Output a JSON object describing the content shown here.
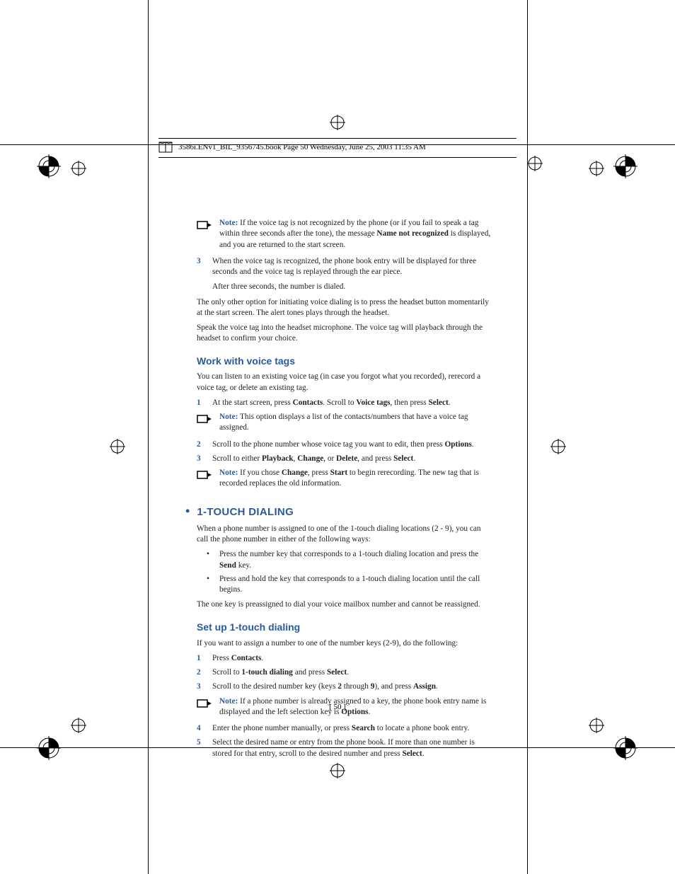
{
  "header": {
    "filename_line": "3586i.ENv1_BIL_9356745.book  Page 50  Wednesday, June 25, 2003  11:35 AM"
  },
  "page_number_display": "[ 50 ]",
  "notes": {
    "label": "Note:",
    "n1_a": " If the voice tag is not recognized by the phone (or if you fail to speak a tag within three seconds after the tone), the message ",
    "n1_bold": "Name not recognized",
    "n1_b": " is displayed, and you are returned to the start screen.",
    "n2": " This option displays a list of the contacts/numbers that have a voice tag assigned.",
    "n3_a": " If you chose ",
    "n3_b1": "Change",
    "n3_c": ", press ",
    "n3_b2": "Start",
    "n3_d": " to begin rerecording. The new tag that is recorded replaces the old information.",
    "n4_a": " If a phone number is already assigned to a key, the phone book entry name is displayed and the left selection key is ",
    "n4_b": "Options",
    "n4_c": "."
  },
  "steps_a": {
    "s3_a": "When the voice tag is recognized, the phone book entry will be displayed for three seconds and the voice tag is replayed through the ear piece.",
    "s3_b": "After three seconds, the number is dialed."
  },
  "paras": {
    "p1": "The only other option for initiating voice dialing is to press the headset button momentarily at the start screen. The alert tones plays through the headset.",
    "p2": "Speak the voice tag into the headset microphone. The voice tag will playback through the headset to confirm your choice.",
    "p3": "You can listen to an existing voice tag (in case you forgot what you recorded), rerecord a voice tag, or delete an existing tag.",
    "p4": "When a phone number is assigned to one of the 1-touch dialing locations (2 - 9), you can call the phone number in either of the following ways:",
    "p5": "The one key is preassigned to dial your voice mailbox number and cannot be reassigned.",
    "p6": "If you want to assign a number to one of the number keys (2-9), do the following:"
  },
  "headings": {
    "h2a": "Work with voice tags",
    "h1": "1-TOUCH DIALING",
    "h2b": "Set up 1-touch dialing"
  },
  "voicetag_steps": {
    "s1_a": "At the start screen, press ",
    "s1_b1": "Contacts",
    "s1_c": ". Scroll to ",
    "s1_b2": "Voice tags",
    "s1_d": ", then press ",
    "s1_b3": "Select",
    "s1_e": ".",
    "s2_a": "Scroll to the phone number whose voice tag you want to edit, then press ",
    "s2_b": "Options",
    "s2_c": ".",
    "s3_a": "Scroll to either ",
    "s3_b1": "Playback",
    "s3_c": ", ",
    "s3_b2": "Change",
    "s3_d": ", or ",
    "s3_b3": "Delete",
    "s3_e": ", and press ",
    "s3_b4": "Select",
    "s3_f": "."
  },
  "touch_bullets": {
    "b1_a": "Press the number key that corresponds to a 1-touch dialing location and press the ",
    "b1_b": "Send",
    "b1_c": " key.",
    "b2": "Press and hold the key that corresponds to a 1-touch dialing location until the call begins."
  },
  "setup_steps": {
    "s1_a": "Press ",
    "s1_b": "Contacts",
    "s1_c": ".",
    "s2_a": "Scroll to ",
    "s2_b": "1-touch dialing",
    "s2_c": " and press ",
    "s2_d": "Select",
    "s2_e": ".",
    "s3_a": "Scroll to the desired number key (keys ",
    "s3_b1": "2",
    "s3_c": " through ",
    "s3_b2": "9",
    "s3_d": "), and press ",
    "s3_b3": "Assign",
    "s3_e": ".",
    "s4_a": "Enter the phone number manually, or press ",
    "s4_b": "Search",
    "s4_c": " to locate a phone book entry.",
    "s5_a": "Select the desired name or entry from the phone book. If more than one number is stored for that entry, scroll to the desired number and press ",
    "s5_b": "Select",
    "s5_c": "."
  },
  "nums": {
    "1": "1",
    "2": "2",
    "3": "3",
    "4": "4",
    "5": "5"
  }
}
